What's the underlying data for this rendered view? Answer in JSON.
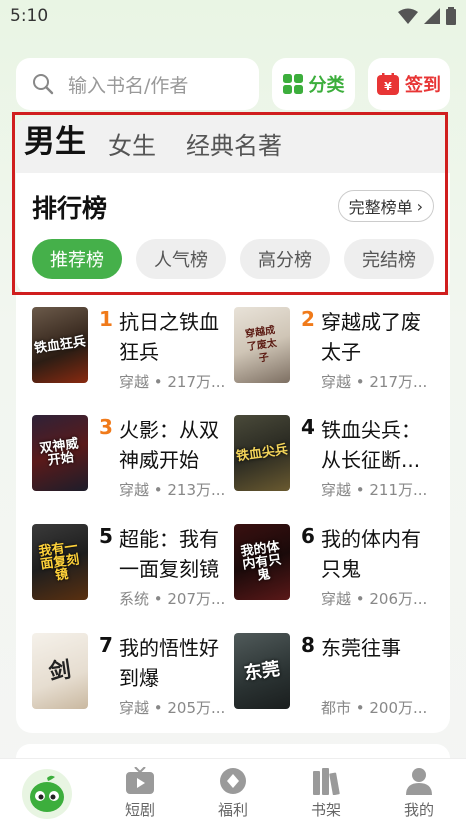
{
  "status": {
    "time": "5:10"
  },
  "search": {
    "placeholder": "输入书名/作者"
  },
  "toolbar": {
    "category_label": "分类",
    "signin_label": "签到"
  },
  "gender_tabs": [
    {
      "label": "男生",
      "active": true
    },
    {
      "label": "女生",
      "active": false
    },
    {
      "label": "经典名著",
      "active": false
    }
  ],
  "ranking": {
    "title": "排行榜",
    "full_list_label": "完整榜单",
    "chips": [
      {
        "label": "推荐榜",
        "active": true
      },
      {
        "label": "人气榜",
        "active": false
      },
      {
        "label": "高分榜",
        "active": false
      },
      {
        "label": "完结榜",
        "active": false
      }
    ]
  },
  "books": [
    {
      "rank": "1",
      "title": "抗日之铁血狂兵",
      "meta": "穿越 • 217万...",
      "cover_text": "铁血狂兵",
      "rank_color": "#f07a1a"
    },
    {
      "rank": "2",
      "title": "穿越成了废太子",
      "meta": "穿越 • 217万...",
      "cover_text": "穿越成了废太子",
      "rank_color": "#f07a1a"
    },
    {
      "rank": "3",
      "title": "火影：从双神威开始",
      "meta": "穿越 • 213万...",
      "cover_text": "双神威开始",
      "rank_color": "#f07a1a"
    },
    {
      "rank": "4",
      "title": "铁血尖兵：从长征断...",
      "meta": "穿越 • 211万...",
      "cover_text": "铁血尖兵",
      "rank_color": "#111111"
    },
    {
      "rank": "5",
      "title": "超能：我有一面复刻镜",
      "meta": "系统 • 207万...",
      "cover_text": "我有一面复刻镜",
      "rank_color": "#111111"
    },
    {
      "rank": "6",
      "title": "我的体内有只鬼",
      "meta": "穿越 • 206万...",
      "cover_text": "我的体内有只鬼",
      "rank_color": "#111111"
    },
    {
      "rank": "7",
      "title": "我的悟性好到爆",
      "meta": "穿越 • 205万...",
      "cover_text": "剑",
      "rank_color": "#111111"
    },
    {
      "rank": "8",
      "title": "东莞往事",
      "meta": "都市 • 200万...",
      "cover_text": "东莞",
      "rank_color": "#111111"
    }
  ],
  "nav": {
    "items": [
      {
        "label": "短剧"
      },
      {
        "label": "福利"
      },
      {
        "label": "书架"
      },
      {
        "label": "我的"
      }
    ]
  },
  "colors": {
    "accent": "#45b04a",
    "highlight": "#d01e1e",
    "signin": "#e83535"
  }
}
